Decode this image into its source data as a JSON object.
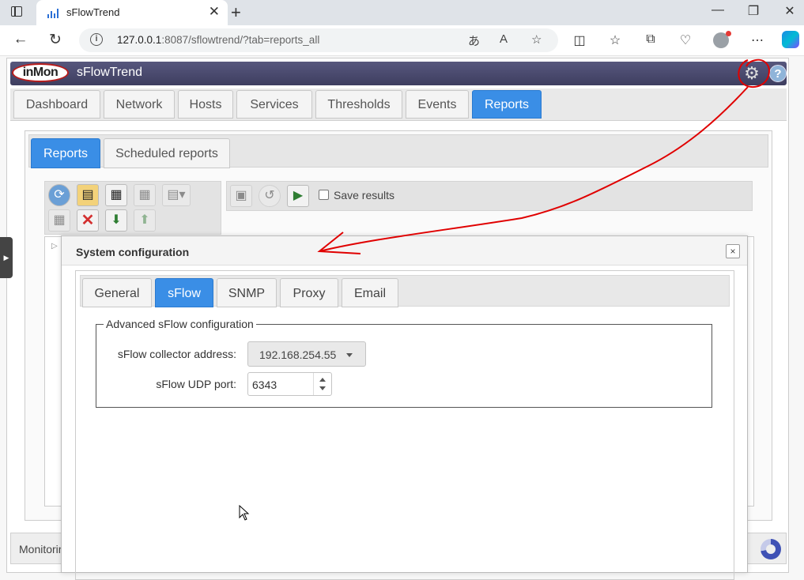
{
  "browser": {
    "tab_title": "sFlowTrend",
    "url_host": "127.0.0.1",
    "url_rest": ":8087/sflowtrend/?tab=reports_all"
  },
  "app": {
    "logo_text": "inMon",
    "title": "sFlowTrend",
    "main_tabs": [
      "Dashboard",
      "Network",
      "Hosts",
      "Services",
      "Thresholds",
      "Events",
      "Reports"
    ],
    "active_main_tab": "Reports",
    "sub_tabs": [
      "Reports",
      "Scheduled reports"
    ],
    "save_results_label": "Save results",
    "footer_text": "Monitorin"
  },
  "dialog": {
    "title": "System configuration",
    "close_label": "×",
    "tabs": [
      "General",
      "sFlow",
      "SNMP",
      "Proxy",
      "Email"
    ],
    "active_tab": "sFlow",
    "fieldset_legend": "Advanced sFlow configuration",
    "collector_label": "sFlow collector address:",
    "collector_value": "192.168.254.55",
    "udp_label": "sFlow UDP port:",
    "udp_value": "6343"
  },
  "colors": {
    "accent": "#3a8ee6",
    "header": "#4a4a6e",
    "annotation": "#e00000"
  }
}
